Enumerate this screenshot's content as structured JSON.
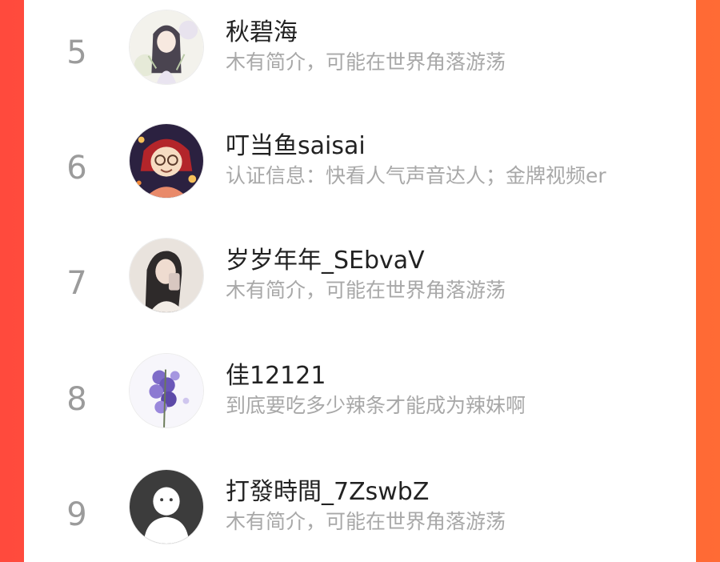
{
  "colors": {
    "background_left": "#ff4a3d",
    "background_right": "#ff6b35",
    "card": "#ffffff",
    "rank_text": "#9b9b9b",
    "name_text": "#222222",
    "bio_text": "#a8a8a8"
  },
  "ranking": {
    "items": [
      {
        "rank": "5",
        "name": "秋碧海",
        "bio": "木有简介，可能在世界角落游荡",
        "avatar_icon": "anime-girl-avatar-icon"
      },
      {
        "rank": "6",
        "name": "叮当鱼saisai",
        "bio": "认证信息：快看人气声音达人；金牌视频er",
        "avatar_icon": "anime-glasses-avatar-icon"
      },
      {
        "rank": "7",
        "name": "岁岁年年_SEbvaV",
        "bio": "木有简介，可能在世界角落游荡",
        "avatar_icon": "selfie-photo-avatar-icon"
      },
      {
        "rank": "8",
        "name": "佳12121",
        "bio": "到底要吃多少辣条才能成为辣妹啊",
        "avatar_icon": "purple-flower-avatar-icon"
      },
      {
        "rank": "9",
        "name": "打發時間_7ZswbZ",
        "bio": "木有简介，可能在世界角落游荡",
        "avatar_icon": "default-user-avatar-icon"
      }
    ]
  }
}
